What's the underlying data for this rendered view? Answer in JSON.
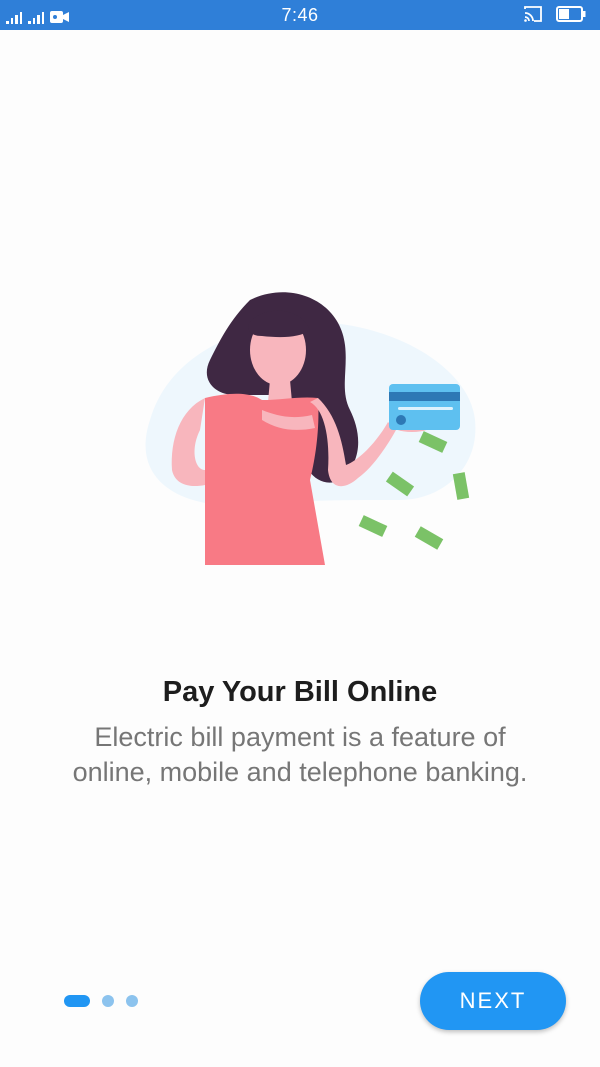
{
  "status_bar": {
    "time": "7:46"
  },
  "onboarding": {
    "title": "Pay Your Bill Online",
    "description": "Electric bill payment is a feature of online, mobile and telephone banking.",
    "page_indicator": {
      "total": 3,
      "active": 1
    },
    "next_label": "NEXT"
  },
  "colors": {
    "status_bar": "#2f7fd8",
    "accent": "#2196f3",
    "title": "#1d1d1d",
    "body_text": "#767676",
    "dress": "#f87a85",
    "hair": "#3f2843",
    "skin": "#f8b6bd",
    "card": "#5ec0f0",
    "money": "#7bc267"
  }
}
